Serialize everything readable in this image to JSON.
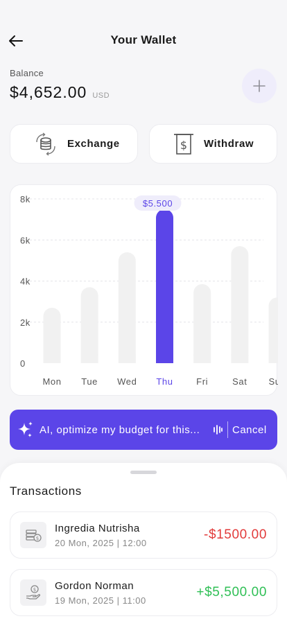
{
  "header": {
    "title": "Your Wallet"
  },
  "balance": {
    "label": "Balance",
    "amount": "$4,652.00",
    "currency": "USD"
  },
  "actions": {
    "exchange_label": "Exchange",
    "withdraw_label": "Withdraw"
  },
  "chart_data": {
    "type": "bar",
    "categories": [
      "Mon",
      "Tue",
      "Wed",
      "Thu",
      "Fri",
      "Sat",
      "Sun"
    ],
    "values": [
      2700,
      3700,
      5400,
      7500,
      3850,
      5700,
      3200
    ],
    "ytick_labels": [
      "8k",
      "6k",
      "4k",
      "2k",
      "0"
    ],
    "ytick_values": [
      8000,
      6000,
      4000,
      2000,
      0
    ],
    "ylim": [
      0,
      8000
    ],
    "highlight_index": 3,
    "highlight_label": "$5.500",
    "grid": true,
    "colors": {
      "bar": "#f1f1f1",
      "highlight": "#5b45e8",
      "tooltip_bg": "#efedfb",
      "tooltip_text": "#5b45e8",
      "axis_text": "#555555"
    }
  },
  "ai_bar": {
    "prompt": "AI, optimize my budget for this...",
    "cancel_label": "Cancel"
  },
  "transactions": {
    "title": "Transactions",
    "items": [
      {
        "name": "Ingredia Nutrisha",
        "date": "20 Mon, 2025 | 12:00",
        "amount": "-$1500.00",
        "icon": "money-stack-icon"
      },
      {
        "name": "Gordon Norman",
        "date": "19 Mon, 2025 | 11:00",
        "amount": "+$5,500.00",
        "icon": "hand-coin-icon"
      }
    ]
  }
}
